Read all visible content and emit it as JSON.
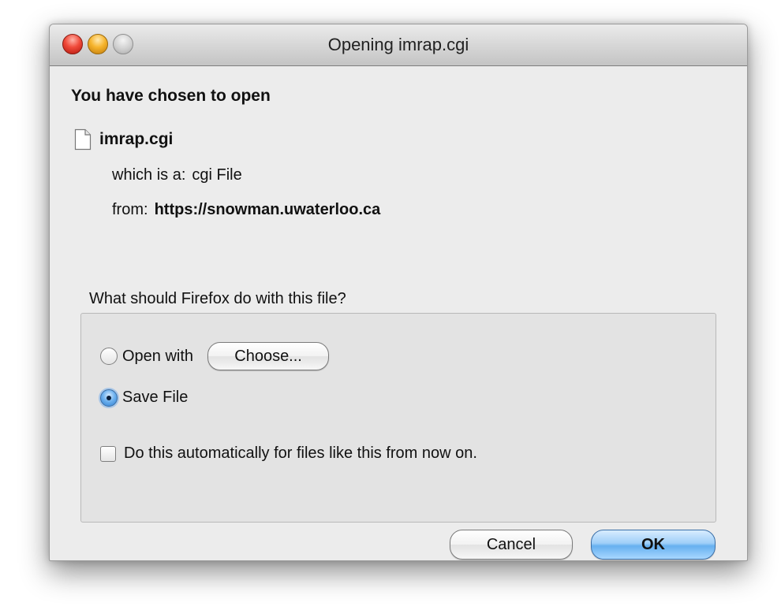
{
  "window": {
    "title": "Opening imrap.cgi"
  },
  "dialog": {
    "heading": "You have chosen to open",
    "file_name": "imrap.cgi",
    "type_label": "which is a:",
    "type_value": "cgi File",
    "from_label": "from:",
    "from_value": "https://snowman.uwaterloo.ca",
    "question": "What should Firefox do with this file?"
  },
  "options": {
    "open_with_label": "Open with",
    "open_with_selected": false,
    "choose_button": "Choose...",
    "save_file_label": "Save File",
    "save_file_selected": true,
    "auto_label": "Do this automatically for files like this from now on.",
    "auto_checked": false
  },
  "buttons": {
    "cancel": "Cancel",
    "ok": "OK"
  },
  "icons": {
    "close": "close-icon",
    "minimize": "minimize-icon",
    "zoom": "zoom-icon",
    "file": "document-icon"
  }
}
